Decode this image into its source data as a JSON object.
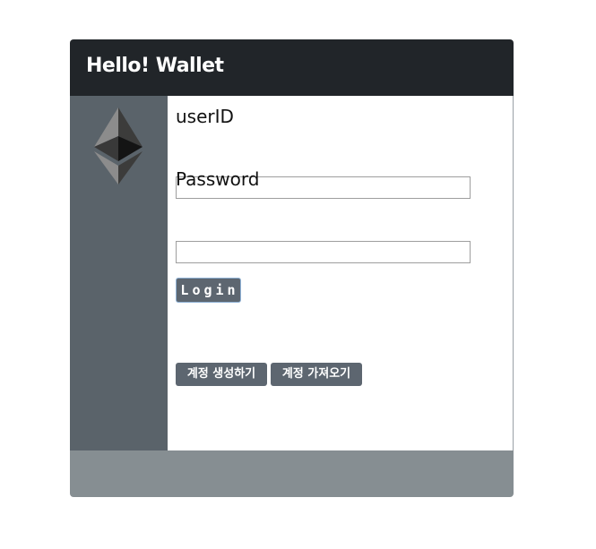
{
  "header": {
    "title": "Hello! Wallet"
  },
  "sidebar": {
    "logo_icon": "ethereum-logo-icon"
  },
  "login_form": {
    "userid_label": "userID",
    "userid_value": "",
    "password_label": "Password",
    "password_value": "",
    "login_button": "Login"
  },
  "account_actions": {
    "create_account": "계정 생성하기",
    "import_account": "계정 가져오기"
  },
  "colors": {
    "header_bg": "#212529",
    "sidebar_bg": "#5a636a",
    "button_bg": "#5d6670",
    "footer_bg": "#868e92"
  }
}
